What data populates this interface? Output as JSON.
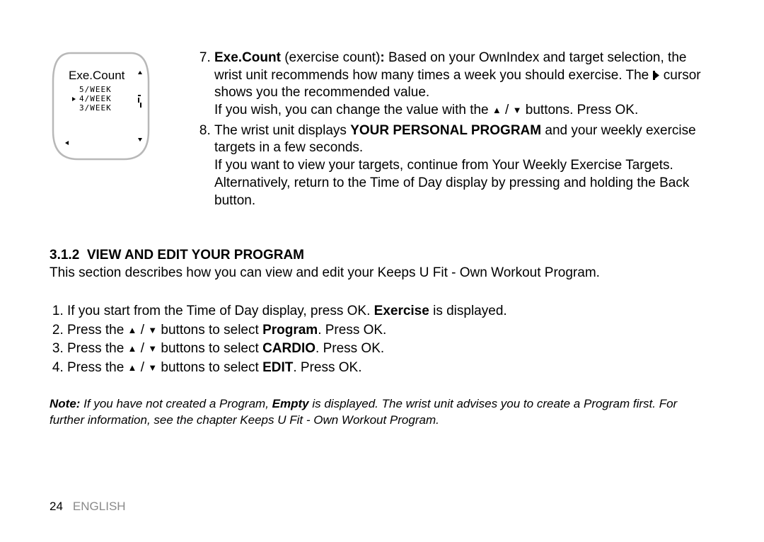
{
  "device": {
    "title": "Exe.Count",
    "options": [
      "5/WEEK",
      "4/WEEK",
      "3/WEEK"
    ],
    "selected_index": 1
  },
  "list7": {
    "bold_lead": "Exe.Count",
    "paren": " (exercise count)",
    "colon_lead": ": ",
    "line_a": "Based on your OwnIndex and target selection, the wrist unit recommends how many times a week you should exercise. The ",
    "line_b": " cursor shows you the recommended value.",
    "line_c_pre": "If you wish, you can change the value with the ",
    "line_c_post": " buttons. Press OK."
  },
  "list8": {
    "line_a_pre": "The wrist unit displays ",
    "line_a_bold": "YOUR PERSONAL PROGRAM",
    "line_a_post": " and your weekly exercise targets in a few seconds.",
    "line_b": "If you want to view your targets, continue from Your Weekly Exercise Targets.",
    "line_c": "Alternatively, return to the Time of Day display by pressing and holding the Back button."
  },
  "section": {
    "num": "3.1.2",
    "title": "VIEW AND EDIT YOUR PROGRAM",
    "intro": "This section describes how you can view and edit your Keeps U Fit - Own Workout Program."
  },
  "steps": {
    "s1_pre": "If you start from the Time of Day display, press OK. ",
    "s1_bold": "Exercise",
    "s1_post": " is displayed.",
    "s2_pre": "Press the ",
    "s2_mid": " buttons to select ",
    "s2_bold": "Program",
    "s2_post": ". Press OK.",
    "s3_pre": "Press the ",
    "s3_mid": " buttons to select ",
    "s3_bold": "CARDIO",
    "s3_post": ". Press OK.",
    "s4_pre": "Press the ",
    "s4_mid": " buttons to select ",
    "s4_bold": "EDIT",
    "s4_post": ". Press OK."
  },
  "note": {
    "label": "Note:",
    "pre": " If you have not created a Program, ",
    "bold": "Empty",
    "post": " is displayed. The wrist unit advises you to create a Program first. For further information, see the chapter Keeps U Fit - Own Workout Program."
  },
  "footer": {
    "page": "24",
    "lang": "ENGLISH"
  }
}
